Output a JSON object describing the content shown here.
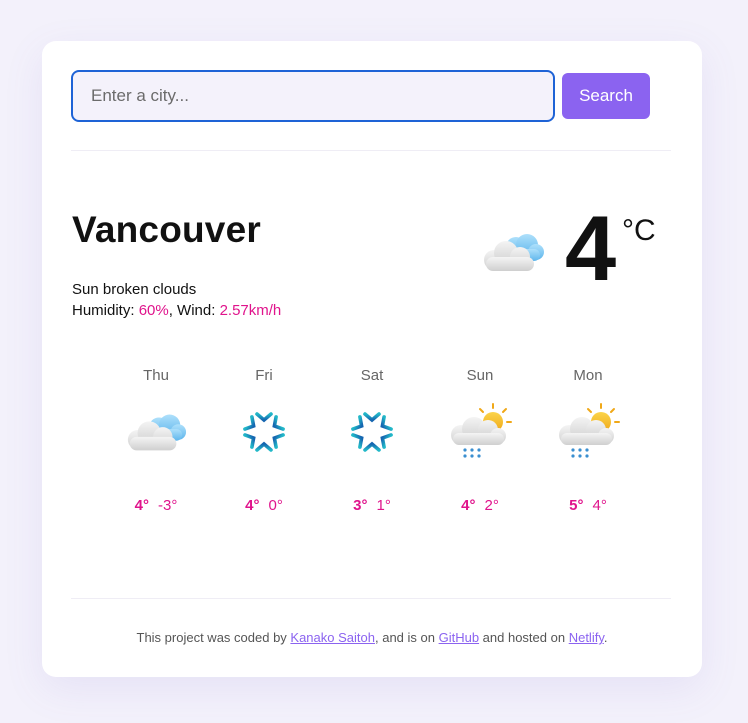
{
  "search": {
    "placeholder": "Enter a city...",
    "button_label": "Search"
  },
  "current": {
    "city": "Vancouver",
    "description": "Sun broken clouds",
    "humidity_label": "Humidity: ",
    "humidity": "60%",
    "wind_label": ", Wind: ",
    "wind": "2.57km/h",
    "temperature": "4",
    "unit": "°C",
    "icon": "broken-clouds-icon"
  },
  "forecast": [
    {
      "day": "Thu",
      "max": "4°",
      "min": "-3°",
      "icon": "broken-clouds-icon"
    },
    {
      "day": "Fri",
      "max": "4°",
      "min": "0°",
      "icon": "snow-icon"
    },
    {
      "day": "Sat",
      "max": "3°",
      "min": "1°",
      "icon": "snow-icon"
    },
    {
      "day": "Sun",
      "max": "4°",
      "min": "2°",
      "icon": "rain-sun-icon"
    },
    {
      "day": "Mon",
      "max": "5°",
      "min": "4°",
      "icon": "rain-sun-icon"
    }
  ],
  "footer": {
    "text1": "This project was coded by ",
    "author": "Kanako Saitoh",
    "text2": ", and is on ",
    "github": "GitHub",
    "text3": " and hosted on ",
    "netlify": "Netlify",
    "text4": "."
  },
  "colors": {
    "accent": "#8b63f0",
    "highlight": "#e0148c",
    "input_border": "#1e63d6"
  }
}
